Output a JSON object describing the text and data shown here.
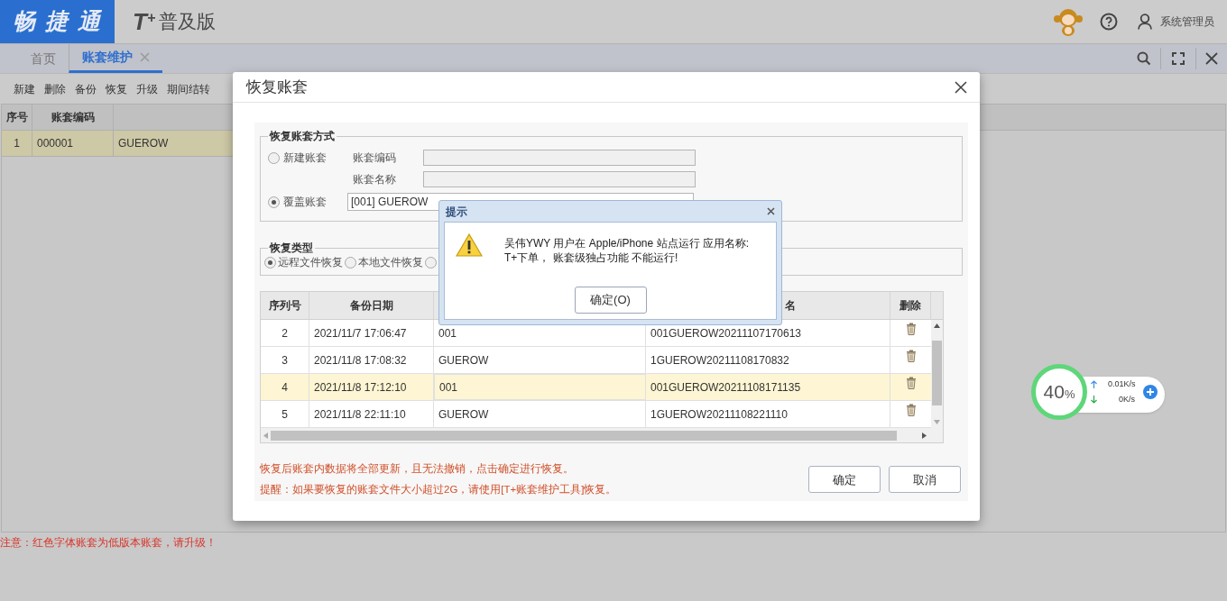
{
  "header": {
    "logo": "畅 捷 通",
    "product_mark": "T",
    "product_plus": "+",
    "product_name": "普及版",
    "user": "系统管理员"
  },
  "tabs": [
    {
      "label": "首页",
      "selected": false,
      "closable": false
    },
    {
      "label": "账套维护",
      "selected": true,
      "closable": true
    }
  ],
  "toolbar": [
    "新建",
    "删除",
    "备份",
    "恢复",
    "升级",
    "期间结转"
  ],
  "table": {
    "columns": [
      "序号",
      "账套编码"
    ],
    "rows": [
      {
        "cells": [
          "1",
          "000001",
          "GUEROW"
        ],
        "selected": true
      }
    ]
  },
  "note": "注意：红色字体账套为低版本账套，请升级！",
  "dialog": {
    "title": "恢复账套",
    "method": {
      "legend": "恢复账套方式",
      "options": [
        {
          "label": "新建账套",
          "selected": false
        },
        {
          "label": "覆盖账套",
          "selected": true
        }
      ],
      "code_label": "账套编码",
      "name_label": "账套名称",
      "target": "[001] GUEROW"
    },
    "restore_type": {
      "legend": "恢复类型",
      "options": [
        {
          "label": "远程文件恢复",
          "selected": true
        },
        {
          "label": "本地文件恢复",
          "selected": false
        },
        {
          "selected": false
        }
      ]
    },
    "backups": {
      "columns": [
        "序列号",
        "备份日期",
        "名",
        "删除"
      ],
      "rows": [
        {
          "cells": [
            "2",
            "2021/11/7 17:06:47",
            "001",
            "001GUEROW20211107170613"
          ],
          "selected": false
        },
        {
          "cells": [
            "3",
            "2021/11/8 17:08:32",
            "GUEROW",
            "1GUEROW20211108170832"
          ],
          "selected": false
        },
        {
          "cells": [
            "4",
            "2021/11/8 17:12:10",
            "001",
            "001GUEROW20211108171135"
          ],
          "selected": true
        },
        {
          "cells": [
            "5",
            "2021/11/8 22:11:10",
            "GUEROW",
            "1GUEROW20211108221110"
          ],
          "selected": false
        }
      ]
    },
    "hints": [
      "恢复后账套内数据将全部更新，且无法撤销，点击确定进行恢复。",
      "提醒：如果要恢复的账套文件大小超过2G，请使用[T+账套维护工具]恢复。"
    ],
    "buttons": [
      "确定",
      "取消"
    ]
  },
  "alert": {
    "title": "提示",
    "message_lines": [
      "吴伟YWY 用户在 Apple/iPhone 站点运行 应用名称:",
      "T+下单， 账套级独占功能 不能运行!"
    ],
    "button": "确定(O)"
  },
  "net_widget": {
    "percent": "40",
    "percent_unit": "%",
    "up": "0.01K/s",
    "down": "0K/s"
  }
}
